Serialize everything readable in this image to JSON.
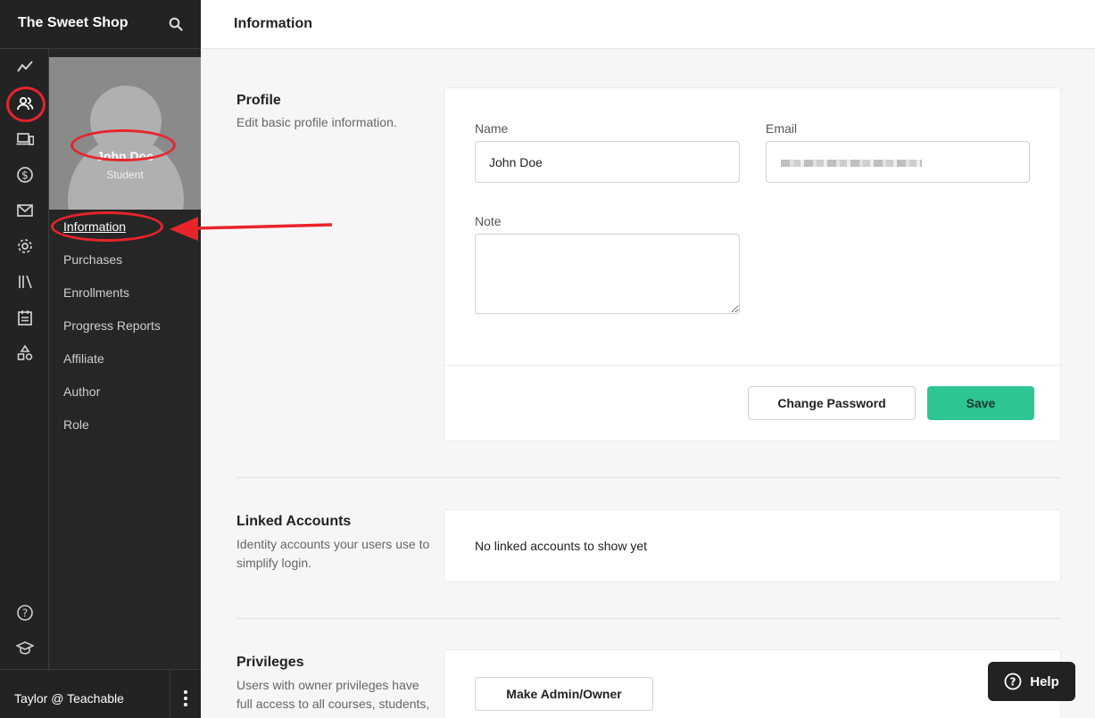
{
  "brand": {
    "name": "The Sweet Shop"
  },
  "profile": {
    "name": "John Doe",
    "role": "Student"
  },
  "subnav": {
    "items": [
      {
        "label": "Information",
        "active": true
      },
      {
        "label": "Purchases"
      },
      {
        "label": "Enrollments"
      },
      {
        "label": "Progress Reports"
      },
      {
        "label": "Affiliate"
      },
      {
        "label": "Author"
      },
      {
        "label": "Role"
      }
    ]
  },
  "rail": {
    "icons": [
      "trend-icon",
      "users-icon",
      "devices-icon",
      "dollar-icon",
      "mail-icon",
      "gear-icon",
      "library-icon",
      "calendar-icon",
      "shapes-icon",
      "help-circle-icon",
      "graduation-cap-icon"
    ]
  },
  "footer": {
    "user": "Taylor @ Teachable"
  },
  "main": {
    "title": "Information"
  },
  "profile_section": {
    "title": "Profile",
    "description": "Edit basic profile information.",
    "name_label": "Name",
    "name_value": "John Doe",
    "email_label": "Email",
    "note_label": "Note",
    "change_password": "Change Password",
    "save": "Save"
  },
  "linked_section": {
    "title": "Linked Accounts",
    "description": "Identity accounts your users use to simplify login.",
    "empty": "No linked accounts to show yet"
  },
  "privileges_section": {
    "title": "Privileges",
    "description": "Users with owner privileges have full access to all courses, students, their to…",
    "make_admin": "Make Admin/Owner"
  },
  "help": {
    "label": "Help"
  },
  "colors": {
    "accent": "#2dc593",
    "sidebar": "#232323",
    "annotation": "#e8242b"
  }
}
